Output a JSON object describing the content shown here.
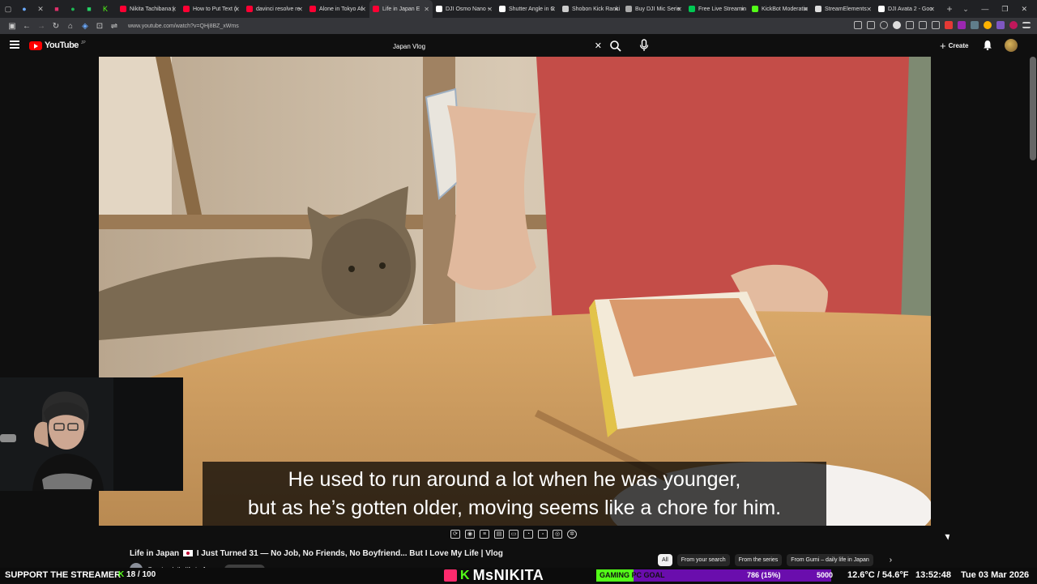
{
  "browser": {
    "tabs": [
      {
        "label": "Nikita Tachibana |",
        "color": "#ff0033"
      },
      {
        "label": "How to Put Text (i",
        "color": "#ff0033"
      },
      {
        "label": "davinci resolve re",
        "color": "#ff0033"
      },
      {
        "label": "Alone in Tokyo Af",
        "color": "#ff0033"
      },
      {
        "label": "Life in Japan E",
        "color": "#ff0033",
        "active": true
      },
      {
        "label": "DJI Osmo Nano - ",
        "color": "#ffffff"
      },
      {
        "label": "Shutter Angle in C",
        "color": "#ffffff"
      },
      {
        "label": "Shobon Kick Ranki",
        "color": "#cccccc"
      },
      {
        "label": "Buy DJI Mic Serie",
        "color": "#aaaaaa"
      },
      {
        "label": "Free Live Streamin",
        "color": "#00c853"
      },
      {
        "label": "KickBot Moderatio",
        "color": "#53fc18"
      },
      {
        "label": "StreamElements - ",
        "color": "#dddddd"
      },
      {
        "label": "DJI Avata 2 - Goo",
        "color": "#ffffff"
      }
    ],
    "new_tab": "+",
    "url": "www.youtube.com/watch?v=QHj8BZ_xWms"
  },
  "youtube": {
    "logo_text": "YouTube",
    "logo_region": "JP",
    "search_value": "Japan Vlog",
    "create_label": "Create",
    "video_title_pre": "Life in Japan",
    "video_title_post": "I Just Turned 31 — No Job, No Friends, No Boyfriend... But I Love My Life | Vlog",
    "channel_name": "Gumi – daily life in Japan",
    "caption_line1": "He used to run around a lot when he was younger,",
    "caption_line2": "but as he’s gotten older, moving seems like a chore for him.",
    "chips": [
      "All",
      "From your search",
      "From the series",
      "From Gumi – daily life in Japan"
    ]
  },
  "stream_overlay": {
    "support": "SUPPORT THE STREAMER",
    "kick_count": "18",
    "kick_goal": "100",
    "kick_sep": "/",
    "streamer_name": "MsNIKITA",
    "goal_label": "GAMING PC GOAL",
    "goal_amount": "786 (15%)",
    "goal_fraction": 0.157,
    "goal_target": "5000",
    "weather": "12.6°C / 54.6°F",
    "time": "13:52:48",
    "date": "Tue 03 Mar 2026"
  }
}
